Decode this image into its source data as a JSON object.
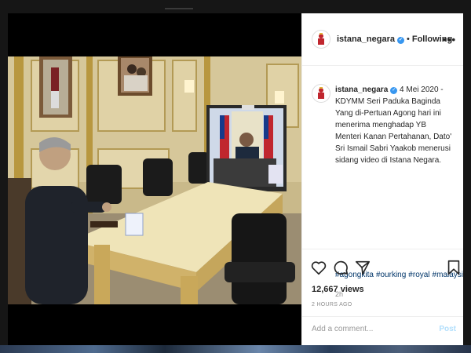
{
  "post": {
    "username": "istana_negara",
    "follow_label": "Following",
    "more_label": "•••",
    "caption_user": "istana_negara",
    "caption_text": "4 Mei 2020 - KDYMM Seri Paduka Baginda Yang di-Pertuan Agong hari ini menerima menghadap YB Menteri Kanan Pertahanan, Dato' Sri Ismail Sabri Yaakob menerusi sidang video di Istana Negara.",
    "hashtags": [
      "#agongkita",
      "#ourking",
      "#royal",
      "#malaysia"
    ],
    "caption_age": "2h",
    "views": "12,667 views",
    "posted_ago": "2 HOURS AGO",
    "comment_placeholder": "Add a comment...",
    "post_label": "Post"
  },
  "icons": {
    "verified": "verified-badge-icon",
    "like": "heart-icon",
    "comment": "comment-icon",
    "share": "share-icon",
    "save": "bookmark-icon"
  },
  "colors": {
    "verified": "#3897f0",
    "hashtag": "#003569",
    "post_button": "#b2dffc"
  }
}
